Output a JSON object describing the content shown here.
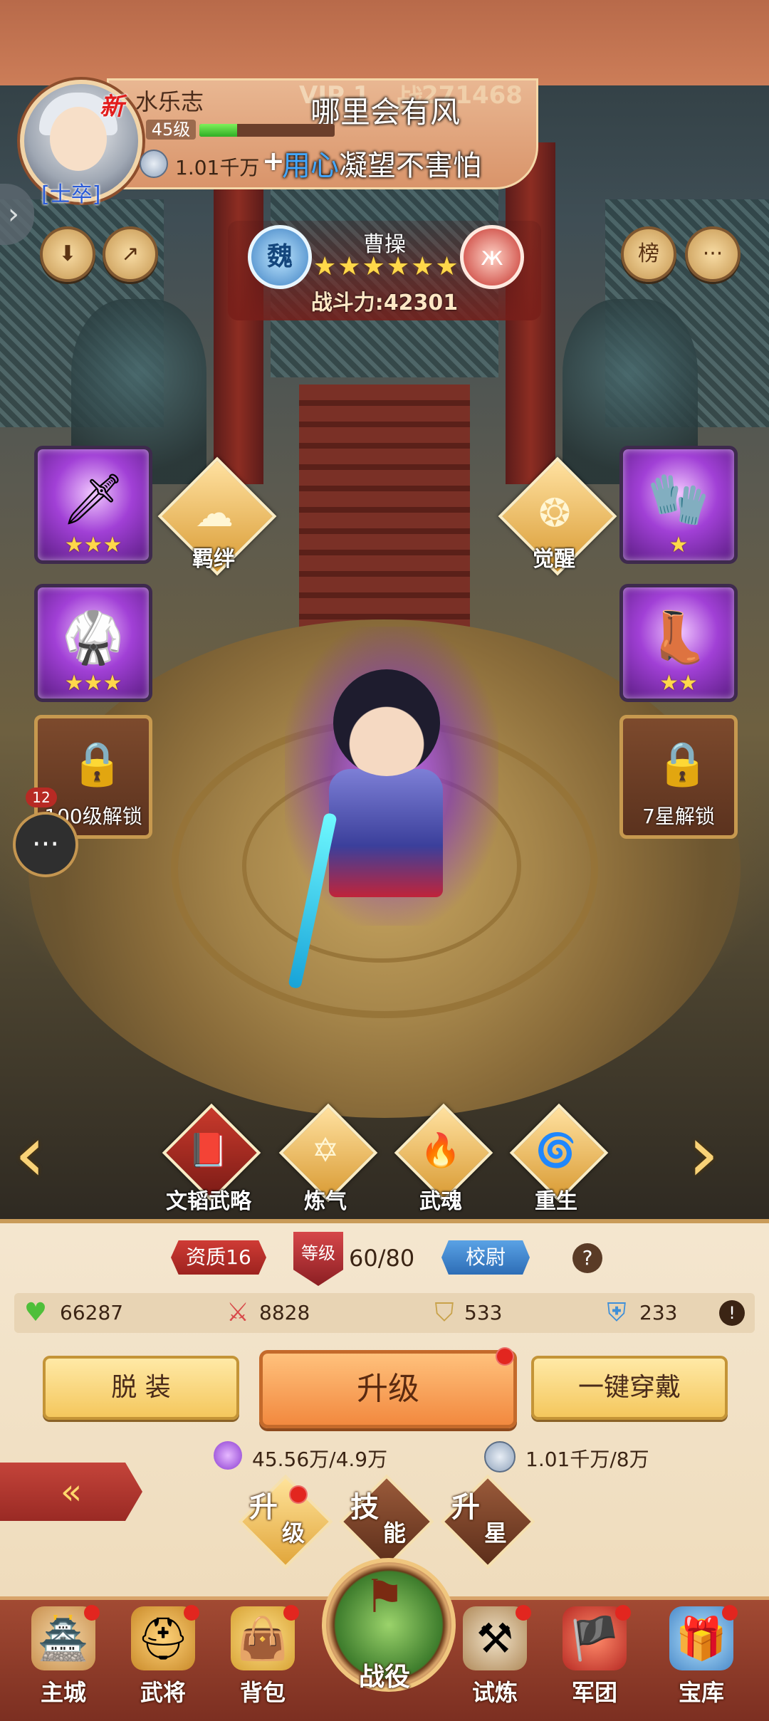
{
  "header": {
    "new_badge": "新",
    "player_name": "水乐志",
    "rank": "[士卒]",
    "vip_text": "VIP 1",
    "power_glyph": "战",
    "power_value": "271468",
    "level": "45级",
    "exp_fraction": 0.28,
    "silver": "1.01千万",
    "plus": "+",
    "chat_line_1": "哪里会有风",
    "chat_line_2_prefix": "用心",
    "chat_line_2": "凝望不害怕"
  },
  "left_buttons": {
    "btn1": "⬇",
    "btn2": "↗"
  },
  "right_buttons": {
    "rank": "榜",
    "chat": "···"
  },
  "hero": {
    "faction": "魏",
    "class_icon": "ж",
    "name": "曹操",
    "stars": "★★★★★★",
    "power_label": "战斗力:",
    "power_value": "42301"
  },
  "equipment": {
    "weapon": {
      "icon": "🗡",
      "stars": "★★★"
    },
    "armor": {
      "icon": "🥋",
      "stars": "★★★"
    },
    "gloves": {
      "icon": "🧤",
      "stars": "★"
    },
    "boots": {
      "icon": "👢",
      "stars": "★★"
    },
    "lock_left": "100级解锁",
    "lock_right": "7星解锁",
    "lock_icon": "🔒"
  },
  "mid_actions": {
    "bond": "羁绊",
    "awaken": "觉醒"
  },
  "chat_float": {
    "badge": "12",
    "icon": "···"
  },
  "skills_row": [
    {
      "label": "文韬武略",
      "icon": "📕"
    },
    {
      "label": "炼气",
      "icon": "✡"
    },
    {
      "label": "武魂",
      "icon": "🔥"
    },
    {
      "label": "重生",
      "icon": "🌀"
    }
  ],
  "nav_arrows": {
    "left": "‹",
    "right": "›"
  },
  "panel": {
    "aptitude": "资质16",
    "level_label": "等级",
    "level_value": "60/80",
    "title_badge": "校尉",
    "help": "?",
    "stats": [
      {
        "icon": "♥",
        "value": "66287",
        "color": "#4fbf3a"
      },
      {
        "icon": "⚔",
        "value": "8828",
        "color": "#d84a4a"
      },
      {
        "icon": "⛉",
        "value": "533",
        "color": "#c8a24a"
      },
      {
        "icon": "⛨",
        "value": "233",
        "color": "#3f8fd8"
      }
    ],
    "info": "!",
    "btn_unequip": "脱 装",
    "btn_upgrade": "升级",
    "btn_equip_all": "一键穿戴",
    "exp_cost": "45.56万/4.9万",
    "silver_cost": "1.01千万/8万",
    "back_icon": "«",
    "tabs": [
      {
        "c1": "升",
        "c2": "级"
      },
      {
        "c1": "技",
        "c2": "能"
      },
      {
        "c1": "升",
        "c2": "星"
      }
    ]
  },
  "navbar": [
    {
      "label": "主城",
      "icon": "🏯"
    },
    {
      "label": "武将",
      "icon": "⛑"
    },
    {
      "label": "背包",
      "icon": "👜"
    },
    {
      "label": "战役",
      "icon": "⚑"
    },
    {
      "label": "试炼",
      "icon": "⚒"
    },
    {
      "label": "军团",
      "icon": "🏴"
    },
    {
      "label": "宝库",
      "icon": "🎁"
    }
  ],
  "colors": {
    "accent_orange": "#f2893f",
    "accent_red": "#9d231f",
    "panel_bg": "#f4e6cf"
  }
}
